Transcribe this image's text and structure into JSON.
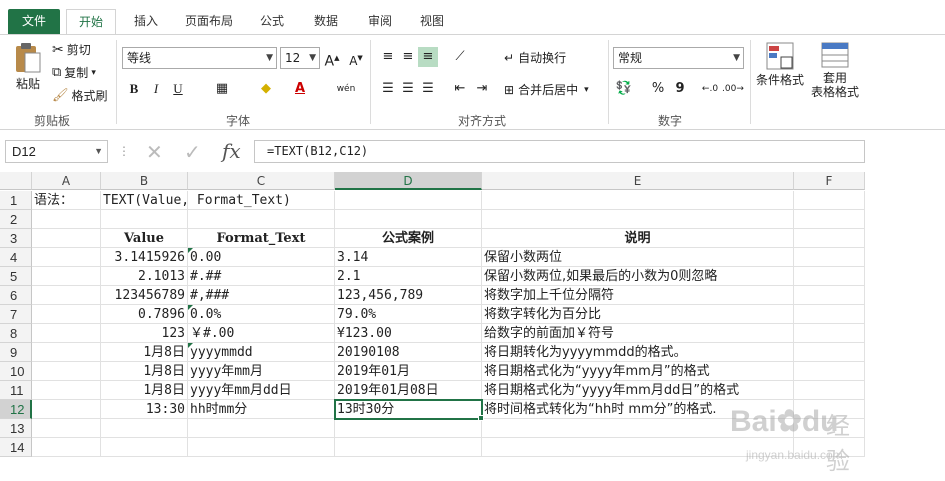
{
  "ribbon": {
    "tabs": [
      "文件",
      "开始",
      "插入",
      "页面布局",
      "公式",
      "数据",
      "审阅",
      "视图"
    ],
    "clipboard": {
      "paste": "粘贴",
      "cut": "剪切",
      "copy": "复制",
      "format_painter": "格式刷",
      "label": "剪贴板"
    },
    "font": {
      "name": "等线",
      "size": "12",
      "label": "字体",
      "bold": "B",
      "italic": "I",
      "underline": "U",
      "phonetic": "wén"
    },
    "alignment": {
      "wrap": "自动换行",
      "merge": "合并后居中",
      "label": "对齐方式"
    },
    "number": {
      "format": "常规",
      "label": "数字",
      "percent": "%",
      "comma": "9"
    },
    "styles": {
      "conditional": "条件格式",
      "table_line1": "套用",
      "table_line2": "表格格式"
    }
  },
  "formula_bar": {
    "name_box": "D12",
    "fx": "fx",
    "formula": "=TEXT(B12,C12)"
  },
  "columns": [
    "A",
    "B",
    "C",
    "D",
    "E",
    "F"
  ],
  "rows": [
    "1",
    "2",
    "3",
    "4",
    "5",
    "6",
    "7",
    "8",
    "9",
    "10",
    "11",
    "12",
    "13",
    "14"
  ],
  "cells": {
    "r1": {
      "a": "语法：",
      "b": "TEXT(Value, Format_Text)"
    },
    "r3": {
      "b": "Value",
      "c": "Format_Text",
      "d": "公式案例",
      "e": "说明"
    },
    "r4": {
      "b": "3.1415926",
      "c": "0.00",
      "d": "3.14",
      "e": "保留小数两位"
    },
    "r5": {
      "b": "2.1013",
      "c": "#.##",
      "d": "2.1",
      "e": "保留小数两位,如果最后的小数为0则忽略"
    },
    "r6": {
      "b": "123456789",
      "c": "#,###",
      "d": "123,456,789",
      "e": "将数字加上千位分隔符"
    },
    "r7": {
      "b": "0.7896",
      "c": "0.0%",
      "d": "79.0%",
      "e": "将数字转化为百分比"
    },
    "r8": {
      "b": "123",
      "c": "￥#.00",
      "d": "¥123.00",
      "e": "给数字的前面加￥符号"
    },
    "r9": {
      "b": "1月8日",
      "c": "yyyymmdd",
      "d": "20190108",
      "e": "将日期转化为yyyymmdd的格式。"
    },
    "r10": {
      "b": "1月8日",
      "c": "yyyy年mm月",
      "d": "2019年01月",
      "e": "将日期格式化为“yyyy年mm月”的格式"
    },
    "r11": {
      "b": "1月8日",
      "c": "yyyy年mm月dd日",
      "d": "2019年01月08日",
      "e": "将日期格式化为“yyyy年mm月dd日”的格式"
    },
    "r12": {
      "b": "13:30",
      "c": "hh时mm分",
      "d": "13时30分",
      "e": "将时间格式转化为“hh时 mm分”的格式."
    }
  },
  "watermark": {
    "brand": "Bai",
    "brand2": "du",
    "text": "经验",
    "url": "jingyan.baidu.com"
  },
  "colors": {
    "accent": "#217346",
    "grid": "#e1e1e1"
  }
}
